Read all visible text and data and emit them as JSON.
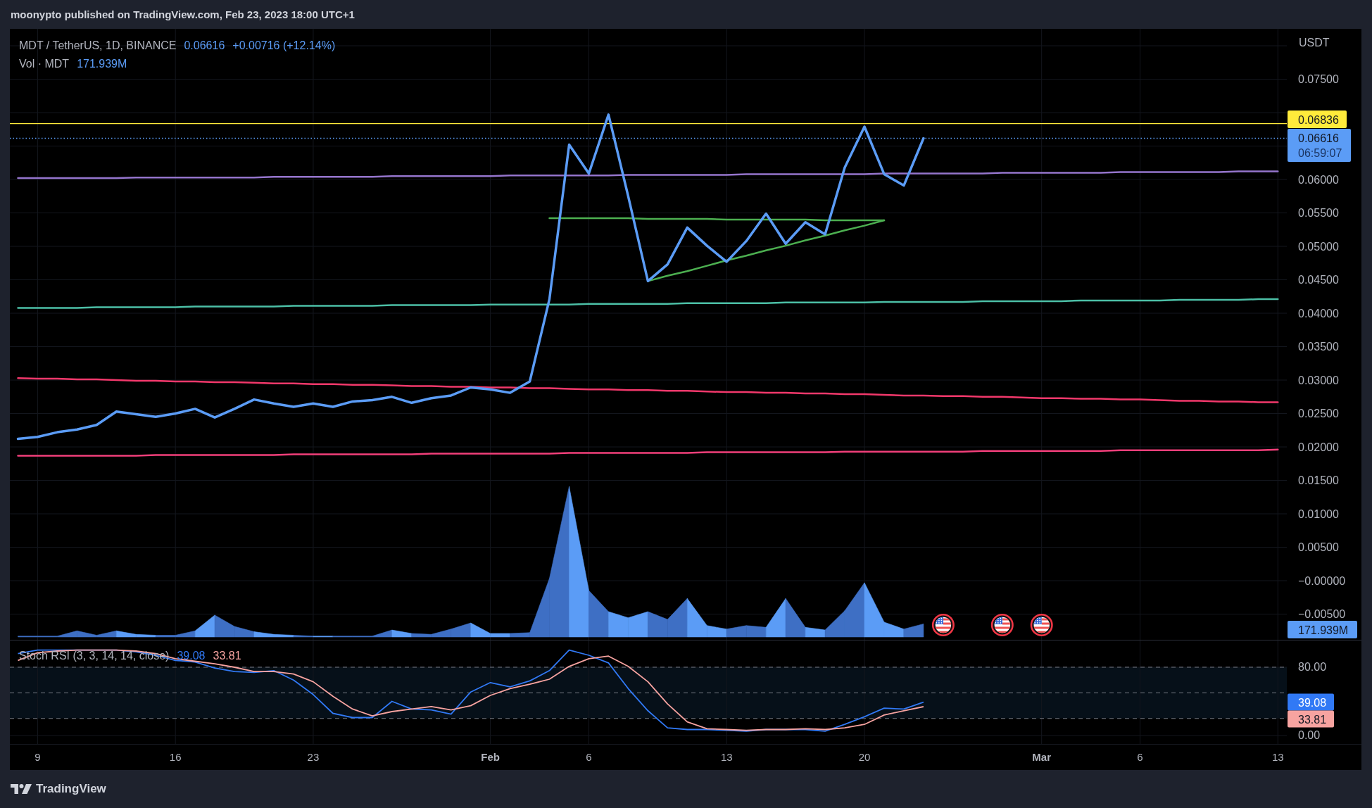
{
  "header": {
    "text": "moonypto published on TradingView.com, Feb 23, 2023 18:00 UTC+1"
  },
  "legend": {
    "price": "0.06616",
    "change": "+0.00716 (+12.14%)",
    "volume_title": "Vol · MDT",
    "volume_value": "171.939M"
  },
  "price_chart": {
    "chart_data": {
      "type": "line",
      "grid": true,
      "ylabel": "USDT",
      "x": [
        "2023-01-08",
        "2023-01-09",
        "2023-01-10",
        "2023-01-11",
        "2023-01-12",
        "2023-01-13",
        "2023-01-14",
        "2023-01-15",
        "2023-01-16",
        "2023-01-17",
        "2023-01-18",
        "2023-01-19",
        "2023-01-20",
        "2023-01-21",
        "2023-01-22",
        "2023-01-23",
        "2023-01-24",
        "2023-01-25",
        "2023-01-26",
        "2023-01-27",
        "2023-01-28",
        "2023-01-29",
        "2023-01-30",
        "2023-01-31",
        "2023-02-01",
        "2023-02-02",
        "2023-02-03",
        "2023-02-04",
        "2023-02-05",
        "2023-02-06",
        "2023-02-07",
        "2023-02-08",
        "2023-02-09",
        "2023-02-10",
        "2023-02-11",
        "2023-02-12",
        "2023-02-13",
        "2023-02-14",
        "2023-02-15",
        "2023-02-16",
        "2023-02-17",
        "2023-02-18",
        "2023-02-19",
        "2023-02-20",
        "2023-02-21",
        "2023-02-22",
        "2023-02-23",
        "2023-02-24",
        "2023-02-25",
        "2023-02-26",
        "2023-02-27",
        "2023-02-28",
        "2023-03-01",
        "2023-03-02",
        "2023-03-03",
        "2023-03-04",
        "2023-03-05",
        "2023-03-06",
        "2023-03-07",
        "2023-03-08",
        "2023-03-09",
        "2023-03-10",
        "2023-03-11",
        "2023-03-12",
        "2023-03-13"
      ],
      "series": [
        {
          "name": "MDT / TetherUS, 1D, BINANCE",
          "color": "#5b9cf6",
          "values": [
            0.0212,
            0.0215,
            0.0222,
            0.0226,
            0.0233,
            0.0253,
            0.0249,
            0.0245,
            0.025,
            0.0257,
            0.0244,
            0.0257,
            0.0271,
            0.0265,
            0.026,
            0.0265,
            0.026,
            0.0268,
            0.027,
            0.0275,
            0.0266,
            0.0273,
            0.0277,
            0.0289,
            0.0286,
            0.0281,
            0.0298,
            0.0421,
            0.0652,
            0.0609,
            0.0697,
            0.0575,
            0.0448,
            0.0473,
            0.0528,
            0.0501,
            0.0477,
            0.0508,
            0.0549,
            0.0504,
            0.0536,
            0.0518,
            0.0618,
            0.0679,
            0.0608,
            0.0591,
            0.06616,
            null,
            null,
            null,
            null,
            null,
            null,
            null,
            null,
            null,
            null,
            null,
            null,
            null,
            null,
            null,
            null,
            null,
            null
          ]
        },
        {
          "color": "#9575cd",
          "values": [
            0.0602,
            0.0602,
            0.0602,
            0.0602,
            0.0602,
            0.0602,
            0.0603,
            0.0603,
            0.0603,
            0.0603,
            0.0603,
            0.0603,
            0.0603,
            0.0604,
            0.0604,
            0.0604,
            0.0604,
            0.0604,
            0.0604,
            0.0605,
            0.0605,
            0.0605,
            0.0605,
            0.0605,
            0.0605,
            0.0606,
            0.0606,
            0.0606,
            0.0606,
            0.0606,
            0.0606,
            0.0607,
            0.0607,
            0.0607,
            0.0607,
            0.0607,
            0.0607,
            0.0608,
            0.0608,
            0.0608,
            0.0608,
            0.0608,
            0.0608,
            0.0608,
            0.0609,
            0.0609,
            0.0609,
            0.0609,
            0.0609,
            0.0609,
            0.061,
            0.061,
            0.061,
            0.061,
            0.061,
            0.061,
            0.0611,
            0.0611,
            0.0611,
            0.0611,
            0.0611,
            0.0611,
            0.0612,
            0.0612,
            0.0612
          ]
        },
        {
          "color": "#4cbfa6",
          "values": [
            0.0408,
            0.0408,
            0.0408,
            0.0408,
            0.0409,
            0.0409,
            0.0409,
            0.0409,
            0.0409,
            0.041,
            0.041,
            0.041,
            0.041,
            0.041,
            0.0411,
            0.0411,
            0.0411,
            0.0411,
            0.0411,
            0.0412,
            0.0412,
            0.0412,
            0.0412,
            0.0412,
            0.0413,
            0.0413,
            0.0413,
            0.0413,
            0.0413,
            0.0414,
            0.0414,
            0.0414,
            0.0414,
            0.0414,
            0.0415,
            0.0415,
            0.0415,
            0.0415,
            0.0415,
            0.0416,
            0.0416,
            0.0416,
            0.0416,
            0.0416,
            0.0417,
            0.0417,
            0.0417,
            0.0417,
            0.0417,
            0.0418,
            0.0418,
            0.0418,
            0.0418,
            0.0418,
            0.0419,
            0.0419,
            0.0419,
            0.0419,
            0.0419,
            0.042,
            0.042,
            0.042,
            0.042,
            0.0421,
            0.0421
          ]
        },
        {
          "color": "#f2386b",
          "values": [
            0.0303,
            0.0302,
            0.0302,
            0.0301,
            0.0301,
            0.03,
            0.0299,
            0.0299,
            0.0298,
            0.0298,
            0.0297,
            0.0297,
            0.0296,
            0.0295,
            0.0295,
            0.0294,
            0.0294,
            0.0293,
            0.0293,
            0.0292,
            0.0291,
            0.0291,
            0.029,
            0.029,
            0.0289,
            0.0289,
            0.0288,
            0.0288,
            0.0287,
            0.0286,
            0.0286,
            0.0285,
            0.0285,
            0.0284,
            0.0284,
            0.0283,
            0.0282,
            0.0282,
            0.0281,
            0.0281,
            0.028,
            0.028,
            0.0279,
            0.0279,
            0.0278,
            0.0277,
            0.0277,
            0.0276,
            0.0276,
            0.0275,
            0.0275,
            0.0274,
            0.0273,
            0.0273,
            0.0272,
            0.0272,
            0.0271,
            0.0271,
            0.027,
            0.0269,
            0.0269,
            0.0268,
            0.0268,
            0.0267,
            0.0267
          ]
        },
        {
          "color": "#f23f7a",
          "values": [
            0.0187,
            0.0187,
            0.0187,
            0.0187,
            0.0187,
            0.0187,
            0.0187,
            0.0188,
            0.0188,
            0.0188,
            0.0188,
            0.0188,
            0.0188,
            0.0188,
            0.0189,
            0.0189,
            0.0189,
            0.0189,
            0.0189,
            0.0189,
            0.0189,
            0.019,
            0.019,
            0.019,
            0.019,
            0.019,
            0.019,
            0.019,
            0.0191,
            0.0191,
            0.0191,
            0.0191,
            0.0191,
            0.0191,
            0.0191,
            0.0192,
            0.0192,
            0.0192,
            0.0192,
            0.0192,
            0.0192,
            0.0192,
            0.0193,
            0.0193,
            0.0193,
            0.0193,
            0.0193,
            0.0193,
            0.0193,
            0.0194,
            0.0194,
            0.0194,
            0.0194,
            0.0194,
            0.0194,
            0.0194,
            0.0195,
            0.0195,
            0.0195,
            0.0195,
            0.0195,
            0.0195,
            0.0195,
            0.0195,
            0.0196
          ]
        },
        {
          "color": "#4caf50",
          "values": [
            null,
            null,
            null,
            null,
            null,
            null,
            null,
            null,
            null,
            null,
            null,
            null,
            null,
            null,
            null,
            null,
            null,
            null,
            null,
            null,
            null,
            null,
            null,
            null,
            null,
            null,
            null,
            0.0542,
            0.0542,
            0.0542,
            0.0542,
            0.0542,
            0.0541,
            0.0541,
            0.0541,
            0.0541,
            0.054,
            0.054,
            0.054,
            0.054,
            0.054,
            0.0539,
            0.0539,
            0.0539,
            0.0539,
            null,
            null,
            null,
            null,
            null,
            null,
            null,
            null,
            null,
            null,
            null,
            null,
            null,
            null,
            null,
            null,
            null,
            null,
            null,
            null
          ]
        },
        {
          "color": "#4caf50",
          "values": [
            null,
            null,
            null,
            null,
            null,
            null,
            null,
            null,
            null,
            null,
            null,
            null,
            null,
            null,
            null,
            null,
            null,
            null,
            null,
            null,
            null,
            null,
            null,
            null,
            null,
            null,
            null,
            null,
            null,
            null,
            null,
            null,
            0.0448,
            0.0456,
            0.0463,
            0.0471,
            0.0479,
            0.0486,
            0.0494,
            0.0501,
            0.0509,
            0.0516,
            0.0524,
            0.0531,
            0.0539,
            null,
            null,
            null,
            null,
            null,
            null,
            null,
            null,
            null,
            null,
            null,
            null,
            null,
            null,
            null,
            null,
            null,
            null,
            null,
            null
          ]
        }
      ],
      "xlim": [
        "2023-01-07T14:10:00Z",
        "2023-03-17T05:53:00Z"
      ],
      "ylim": [
        -0.00884,
        0.08253
      ],
      "yticks": [
        {
          "value": 0.075,
          "label": "0.07500"
        },
        {
          "value": 0.06,
          "label": "0.06000"
        },
        {
          "value": 0.055,
          "label": "0.05500"
        },
        {
          "value": 0.05,
          "label": "0.05000"
        },
        {
          "value": 0.045,
          "label": "0.04500"
        },
        {
          "value": 0.04,
          "label": "0.04000"
        },
        {
          "value": 0.035,
          "label": "0.03500"
        },
        {
          "value": 0.03,
          "label": "0.03000"
        },
        {
          "value": 0.025,
          "label": "0.02500"
        },
        {
          "value": 0.02,
          "label": "0.02000"
        },
        {
          "value": 0.015,
          "label": "0.01500"
        },
        {
          "value": 0.01,
          "label": "0.01000"
        },
        {
          "value": 0.005,
          "label": "0.00500"
        },
        {
          "value": 0,
          "label": "−0.00000"
        },
        {
          "value": -0.005,
          "label": "−0.00500"
        }
      ],
      "ref_lines": [
        {
          "axis": "y",
          "value": 0.06836,
          "label": "0.06836",
          "color": "#ffeb3b"
        },
        {
          "axis": "y",
          "value": 0.06616,
          "label": "0.06616",
          "color": "#5b9cf6"
        }
      ]
    },
    "countdown": "06:59:07",
    "volume": {
      "axis_tag": "171.939M"
    }
  },
  "stoch_rsi": {
    "title": "Stoch RSI (3, 3, 14, 14, close)",
    "legend_values": [
      "39.08",
      "33.81"
    ],
    "axis_tags": [
      "39.08",
      "33.81"
    ],
    "chart_data": {
      "type": "line",
      "grid": true,
      "x": [
        "2023-01-08",
        "2023-01-09",
        "2023-01-10",
        "2023-01-11",
        "2023-01-12",
        "2023-01-13",
        "2023-01-14",
        "2023-01-15",
        "2023-01-16",
        "2023-01-17",
        "2023-01-18",
        "2023-01-19",
        "2023-01-20",
        "2023-01-21",
        "2023-01-22",
        "2023-01-23",
        "2023-01-24",
        "2023-01-25",
        "2023-01-26",
        "2023-01-27",
        "2023-01-28",
        "2023-01-29",
        "2023-01-30",
        "2023-01-31",
        "2023-02-01",
        "2023-02-02",
        "2023-02-03",
        "2023-02-04",
        "2023-02-05",
        "2023-02-06",
        "2023-02-07",
        "2023-02-08",
        "2023-02-09",
        "2023-02-10",
        "2023-02-11",
        "2023-02-12",
        "2023-02-13",
        "2023-02-14",
        "2023-02-15",
        "2023-02-16",
        "2023-02-17",
        "2023-02-18",
        "2023-02-19",
        "2023-02-20",
        "2023-02-21",
        "2023-02-22",
        "2023-02-23"
      ],
      "series": [
        {
          "color": "#3179f5",
          "values": [
            96,
            100,
            100,
            100,
            100,
            100,
            98,
            94,
            88,
            86,
            79,
            75,
            74,
            76,
            65,
            48,
            26,
            21,
            21,
            40,
            31,
            30,
            25,
            51,
            62,
            57,
            64,
            76,
            100,
            94,
            85,
            55,
            29,
            9,
            7,
            7,
            6,
            5,
            7,
            7,
            7,
            5,
            13,
            22,
            32,
            31,
            39.08
          ]
        },
        {
          "color": "#f7a3a0",
          "values": [
            88,
            97,
            99,
            100,
            100,
            100,
            99,
            96,
            90,
            87,
            84,
            80,
            75,
            75,
            72,
            63,
            46,
            31,
            23,
            28,
            31,
            34,
            30,
            35,
            47,
            55,
            60,
            66,
            81,
            90,
            93,
            81,
            63,
            37,
            16,
            8,
            7,
            6,
            7,
            7,
            8,
            7,
            9,
            13,
            24,
            29,
            33.81
          ]
        }
      ],
      "xlim": [
        "2023-01-07T14:10:00Z",
        "2023-03-17T05:53:00Z"
      ],
      "ylim": [
        -9.9,
        111.34
      ],
      "xticks": [
        {
          "value": "2023-01-09",
          "label": "9"
        },
        {
          "value": "2023-01-16",
          "label": "16"
        },
        {
          "value": "2023-01-23",
          "label": "23"
        },
        {
          "value": "2023-02-01",
          "label": "Feb"
        },
        {
          "value": "2023-02-06",
          "label": "6"
        },
        {
          "value": "2023-02-13",
          "label": "13"
        },
        {
          "value": "2023-02-20",
          "label": "20"
        },
        {
          "value": "2023-03-01",
          "label": "Mar"
        },
        {
          "value": "2023-03-06",
          "label": "6"
        },
        {
          "value": "2023-03-13",
          "label": "13"
        }
      ],
      "yticks": [
        {
          "value": 80,
          "label": "80.00"
        },
        {
          "value": 0,
          "label": "0.00"
        }
      ],
      "bands": [
        {
          "axis": "y",
          "from": 20,
          "to": 80
        }
      ],
      "ref_lines": [
        {
          "axis": "y",
          "value": 80
        },
        {
          "axis": "y",
          "value": 50
        },
        {
          "axis": "y",
          "value": 20
        }
      ]
    }
  },
  "footer": {
    "brand": "TradingView"
  }
}
